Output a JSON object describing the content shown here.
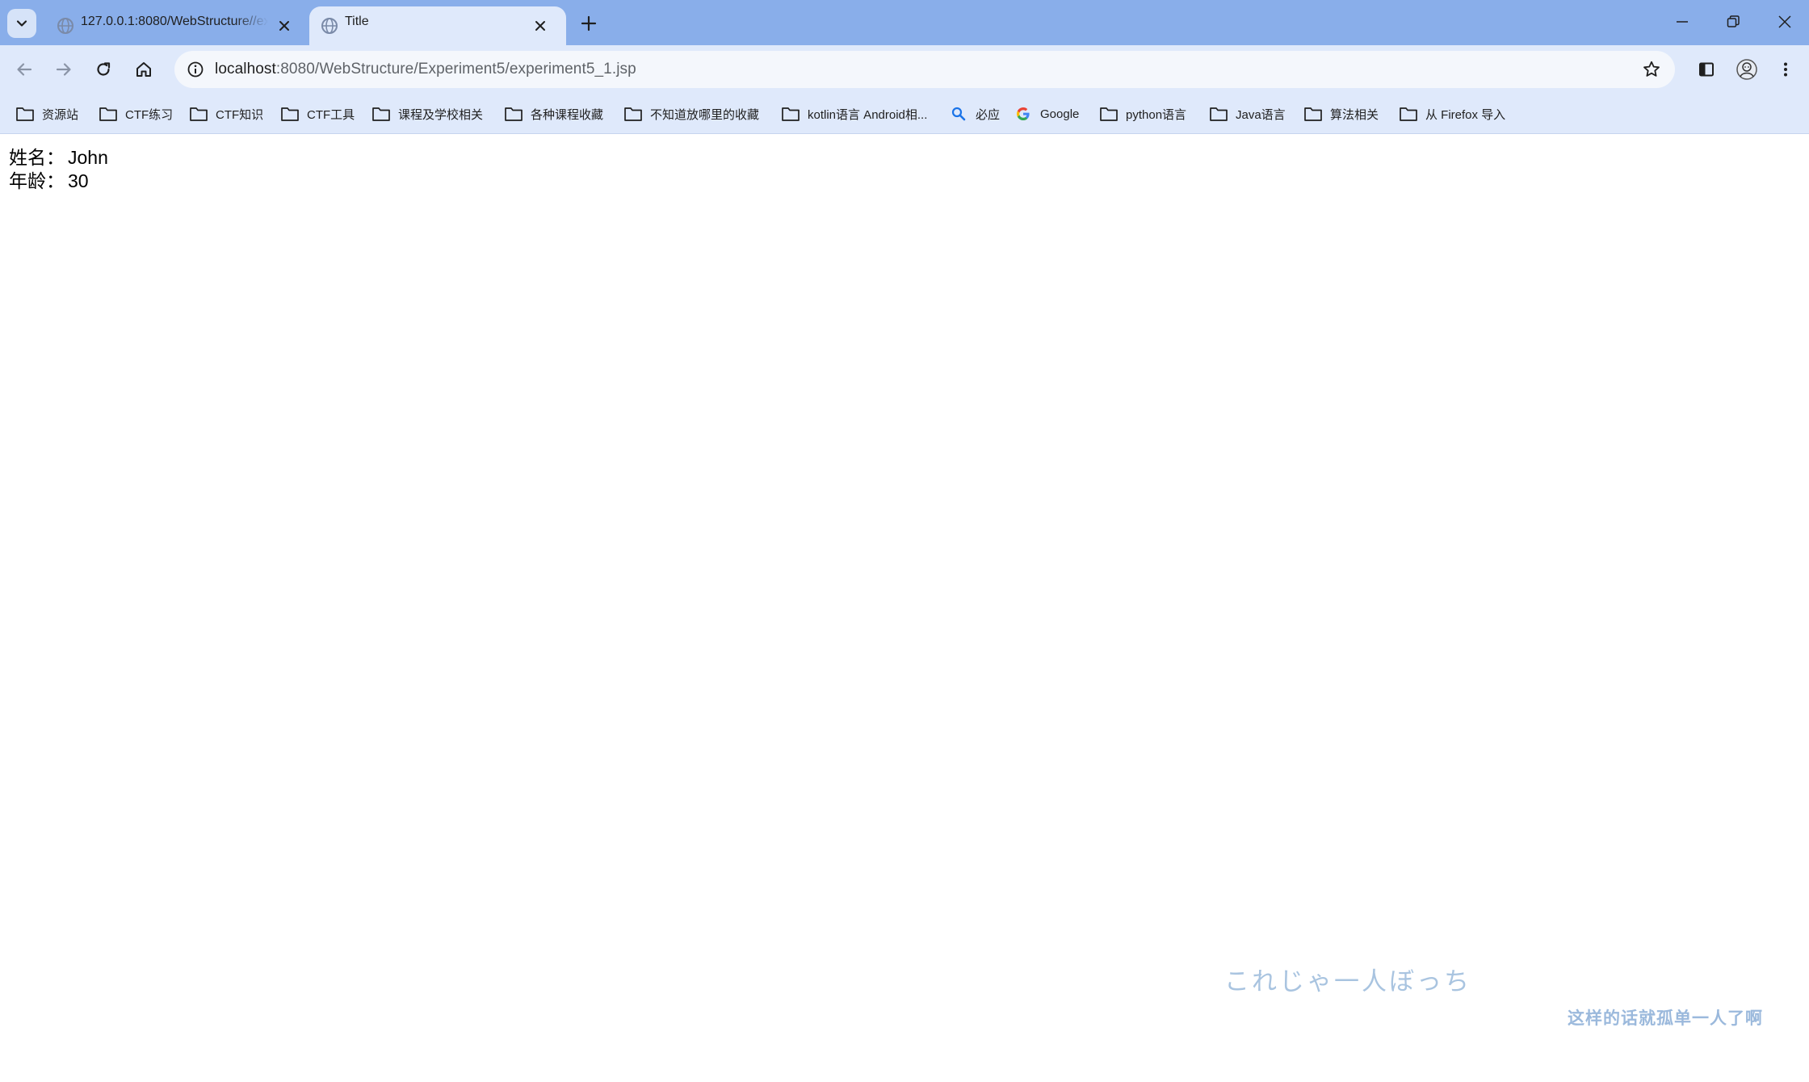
{
  "browser": {
    "tabs": [
      {
        "title": "127.0.0.1:8080/WebStructure//experiment5/experiment5_1.jsp",
        "active": false
      },
      {
        "title": "Title",
        "active": true
      }
    ],
    "address_bar": {
      "host": "localhost",
      "path": ":8080/WebStructure/Experiment5/experiment5_1.jsp"
    },
    "bookmarks": [
      {
        "label": "资源站",
        "icon": "folder-icon"
      },
      {
        "label": "CTF练习",
        "icon": "folder-icon"
      },
      {
        "label": "CTF知识",
        "icon": "folder-icon"
      },
      {
        "label": "CTF工具",
        "icon": "folder-icon"
      },
      {
        "label": "课程及学校相关",
        "icon": "folder-icon"
      },
      {
        "label": "各种课程收藏",
        "icon": "folder-icon"
      },
      {
        "label": "不知道放哪里的收藏",
        "icon": "folder-icon"
      },
      {
        "label": "kotlin语言 Android相...",
        "icon": "folder-icon"
      },
      {
        "label": "必应",
        "icon": "search-icon"
      },
      {
        "label": "Google",
        "icon": "google-icon"
      },
      {
        "label": "python语言",
        "icon": "folder-icon"
      },
      {
        "label": "Java语言",
        "icon": "folder-icon"
      },
      {
        "label": "算法相关",
        "icon": "folder-icon"
      },
      {
        "label": "从 Firefox 导入",
        "icon": "folder-icon"
      }
    ],
    "colors": {
      "tabstrip": "#89aeea",
      "toolbar": "#dfe9fb",
      "omnibox": "#f4f7fc"
    }
  },
  "page": {
    "name_label": "姓名：",
    "name_value": "John",
    "age_label": "年龄：",
    "age_value": "30"
  },
  "overlay": {
    "jp_text": "これじゃ一人ぼっち",
    "cn_text": "这样的话就孤单一人了啊"
  }
}
